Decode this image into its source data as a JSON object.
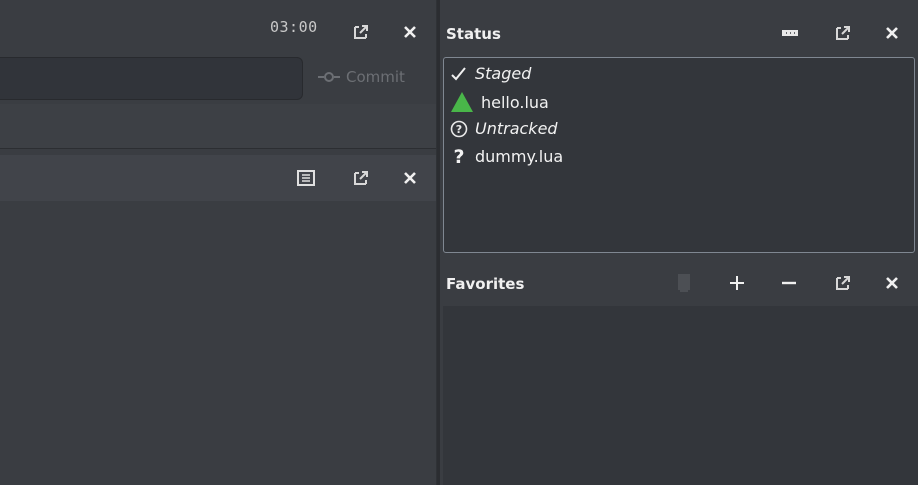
{
  "left_panel": {
    "time": "03:00",
    "commit_label": "Commit",
    "icons": {
      "popout": "popout-icon",
      "close": "close-icon",
      "commit": "commit-icon",
      "view_list": "list-view-icon"
    }
  },
  "status_panel": {
    "title": "Status",
    "items": [
      {
        "icon": "check-icon",
        "label": "Staged",
        "italic": true
      },
      {
        "icon": "green-triangle-icon",
        "label": "hello.lua",
        "italic": false
      },
      {
        "icon": "question-circle-icon",
        "label": "Untracked",
        "italic": true
      },
      {
        "icon": "question-mark-icon",
        "label": "dummy.lua",
        "italic": false
      }
    ],
    "icons": {
      "options": "dots-icon",
      "popout": "popout-icon",
      "close": "close-icon"
    }
  },
  "favorites_panel": {
    "title": "Favorites",
    "icons": {
      "bookmark": "bookmark-icon",
      "add": "plus-icon",
      "remove": "minus-icon",
      "popout": "popout-icon",
      "close": "close-icon"
    }
  },
  "colors": {
    "background": "#3a3d42",
    "panel_bg": "#33363b",
    "accent_green": "#49b649",
    "border": "#7f8791"
  }
}
